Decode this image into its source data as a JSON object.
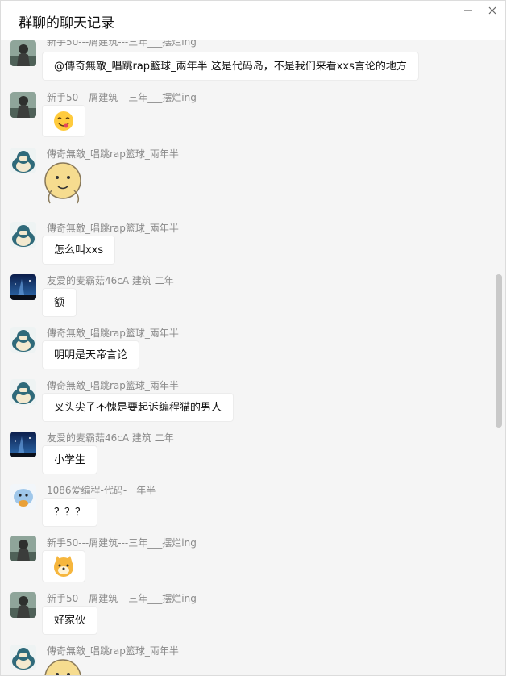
{
  "window": {
    "title": "群聊的聊天记录",
    "minimize_icon": "minimize-icon",
    "close_icon": "close-icon"
  },
  "messages": [
    {
      "sender": "新手50---屑建筑---三年___摆烂ing",
      "avatar": "statue-avatar",
      "type": "text",
      "text": "@傳奇無敵_唱跳rap籃球_兩年半 这是代码岛，不是我们来看xxs言论的地方"
    },
    {
      "sender": "新手50---屑建筑---三年___摆烂ing",
      "avatar": "statue-avatar",
      "type": "sticker",
      "sticker": "yummy-emoji-sticker"
    },
    {
      "sender": "傳奇無敵_唱跳rap籃球_兩年半",
      "avatar": "snorlax-avatar",
      "type": "sticker",
      "sticker": "yellow-ball-face-sticker"
    },
    {
      "sender": "傳奇無敵_唱跳rap籃球_兩年半",
      "avatar": "snorlax-avatar",
      "type": "text",
      "text": "怎么叫xxs"
    },
    {
      "sender": "友爱的麦霸菇46cA   建筑 二年",
      "avatar": "night-sky-avatar",
      "type": "text",
      "text": "额"
    },
    {
      "sender": "傳奇無敵_唱跳rap籃球_兩年半",
      "avatar": "snorlax-avatar",
      "type": "text",
      "text": "明明是天帝言论"
    },
    {
      "sender": "傳奇無敵_唱跳rap籃球_兩年半",
      "avatar": "snorlax-avatar",
      "type": "text",
      "text": "叉头尖子不愧是要起诉编程猫的男人"
    },
    {
      "sender": "友爱的麦霸菇46cA   建筑 二年",
      "avatar": "night-sky-avatar",
      "type": "text",
      "text": "小学生"
    },
    {
      "sender": "1086爱编程-代码-一年半",
      "avatar": "cartoon-avatar",
      "type": "text",
      "text": "？？？"
    },
    {
      "sender": "新手50---屑建筑---三年___摆烂ing",
      "avatar": "statue-avatar",
      "type": "sticker",
      "sticker": "doge-emoji-sticker"
    },
    {
      "sender": "新手50---屑建筑---三年___摆烂ing",
      "avatar": "statue-avatar",
      "type": "text",
      "text": "好家伙"
    },
    {
      "sender": "傳奇無敵_唱跳rap籃球_兩年半",
      "avatar": "snorlax-avatar",
      "type": "sticker",
      "sticker": "yellow-ball-face-sticker"
    }
  ]
}
